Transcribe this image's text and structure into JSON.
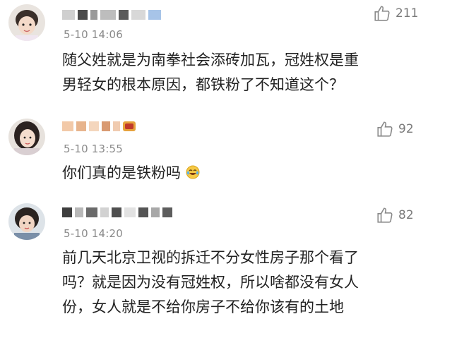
{
  "comments": [
    {
      "time": "5-10 14:06",
      "likes": "211",
      "text_lines": [
        "随父姓就是为南拳社会添砖加瓦，冠姓权是重",
        "男轻女的根本原因，都铁粉了不知道这个？"
      ],
      "name_visible": "pixelated"
    },
    {
      "time": "5-10 13:55",
      "likes": "92",
      "text_lines": [
        "你们真的是铁粉吗"
      ],
      "emoji": "laughing-crying-emoji",
      "name_visible": "pixelated"
    },
    {
      "time": "5-10 14:20",
      "likes": "82",
      "text_lines": [
        "前几天北京卫视的拆迁不分女性房子那个看了",
        "吗？就是因为没有冠姓权，所以啥都没有女人",
        "份，女人就是不给你房子不给你该有的土地"
      ],
      "name_visible": "pixelated"
    }
  ],
  "icons": {
    "like": "thumbs-up-icon"
  },
  "colors": {
    "text": "#222222",
    "meta": "#8a8a8a",
    "like": "#7a7a7a"
  }
}
